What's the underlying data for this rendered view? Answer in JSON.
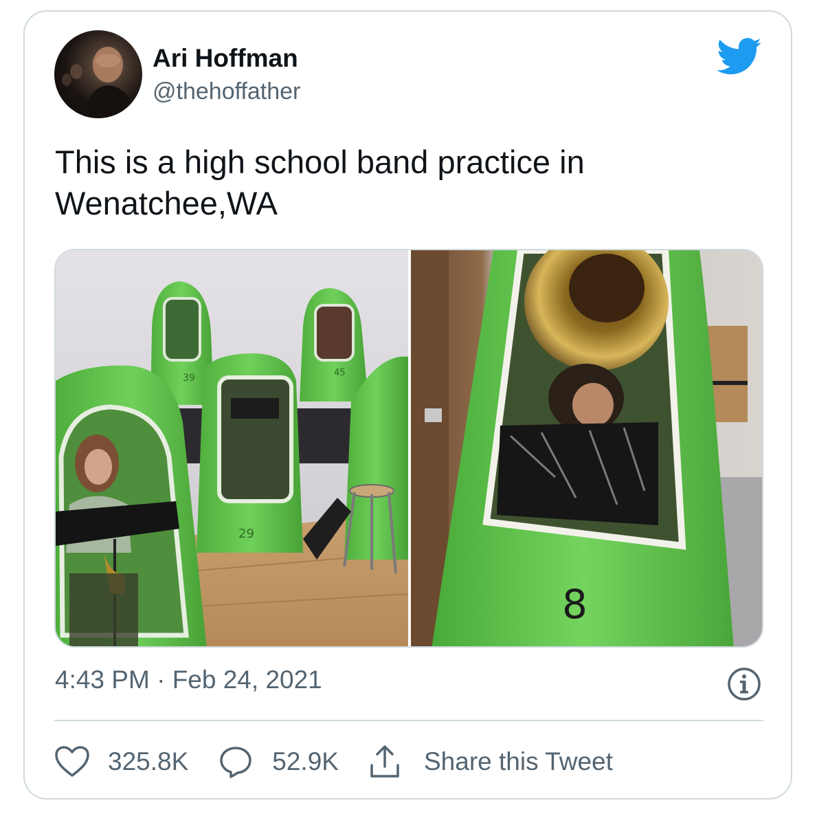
{
  "author": {
    "name": "Ari Hoffman",
    "handle": "@thehoffather"
  },
  "logo": {
    "icon": "twitter-bird-icon",
    "color": "#1d9bf0"
  },
  "tweet": {
    "text_lines": [
      "This is a high school band practice in",
      "Wenatchee,WA"
    ],
    "time": "4:43 PM",
    "separator": "·",
    "date": "Feb 24, 2021"
  },
  "media": {
    "left_tent_numbers": [
      "39",
      "45",
      "29"
    ],
    "right_tent_number": "8"
  },
  "actions": {
    "likes": "325.8K",
    "replies": "52.9K",
    "share_label": "Share this Tweet"
  },
  "colors": {
    "text": "#0f1419",
    "secondary": "#536471",
    "border": "#cfd9de",
    "tent_green": "#5cc24a"
  }
}
